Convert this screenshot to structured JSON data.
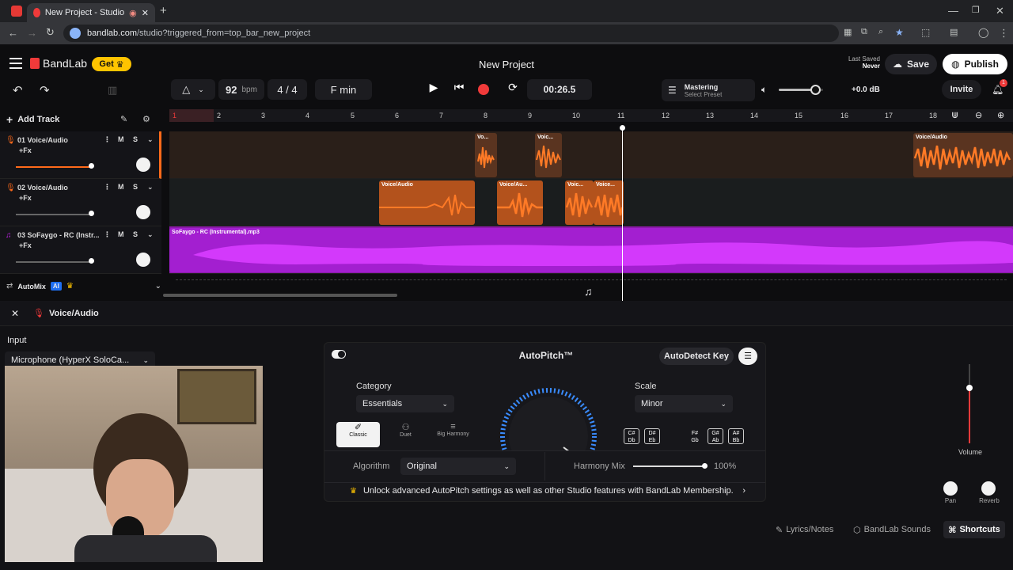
{
  "browser": {
    "tab_title": "New Project - Studio",
    "url_domain": "bandlab.com",
    "url_path": "/studio?triggered_from=top_bar_new_project"
  },
  "header": {
    "brand": "BandLab",
    "get_label": "Get",
    "project_title": "New Project",
    "last_saved_label": "Last Saved",
    "last_saved_value": "Never",
    "save_label": "Save",
    "publish_label": "Publish",
    "tempo_value": "92",
    "tempo_unit": "bpm",
    "time_sig": "4 / 4",
    "key": "F min",
    "time_display": "00:26.5",
    "mastering_label": "Mastering",
    "mastering_preset": "Select Preset",
    "db_value": "+0.0 dB",
    "invite_label": "Invite",
    "notification_count": "1"
  },
  "tracks_panel": {
    "add_track_label": "Add Track",
    "automix_label": "AutoMix",
    "ai_badge": "AI"
  },
  "ruler": [
    "1",
    "2",
    "3",
    "4",
    "5",
    "6",
    "7",
    "8",
    "9",
    "10",
    "11",
    "12",
    "13",
    "14",
    "15",
    "16",
    "17",
    "18"
  ],
  "tracks": [
    {
      "name": "01  Voice/Audio",
      "fx": "+Fx",
      "m": "M",
      "s": "S",
      "color": "#ff6a1a"
    },
    {
      "name": "02  Voice/Audio",
      "fx": "+Fx",
      "m": "M",
      "s": "S",
      "color": "#ff6a1a"
    },
    {
      "name": "03  SoFaygo - RC (Instr...",
      "fx": "+Fx",
      "m": "M",
      "s": "S",
      "color": "#c020e8"
    }
  ],
  "clips": {
    "t1": [
      "Vo...",
      "Voic...",
      "Voice/Audio"
    ],
    "t2": [
      "Voice/Audio",
      "Voice/Au...",
      "Voic...",
      "Voice..."
    ],
    "t3": [
      "SoFaygo - RC (Instrumental).mp3"
    ]
  },
  "bottom": {
    "track_title": "Voice/Audio",
    "input_label": "Input",
    "input_device": "Microphone (HyperX SoloCa...",
    "autopitch_title": "AutoPitch™",
    "autodetect_label": "AutoDetect Key",
    "category_label": "Category",
    "category_value": "Essentials",
    "scale_label": "Scale",
    "scale_value": "Minor",
    "modes": [
      "Classic",
      "Duet",
      "Big Harmony"
    ],
    "algorithm_label": "Algorithm",
    "algorithm_value": "Original",
    "harmony_mix_label": "Harmony Mix",
    "harmony_mix_value": "100%",
    "unlock_text": "Unlock advanced AutoPitch settings as well as other Studio features with BandLab Membership.",
    "notes": [
      {
        "top": "C#",
        "bot": "Db"
      },
      {
        "top": "D#",
        "bot": "Eb"
      },
      {
        "top": "F#",
        "bot": "Gb"
      },
      {
        "top": "G#",
        "bot": "Ab"
      },
      {
        "top": "A#",
        "bot": "Bb"
      }
    ],
    "volume_label": "Volume",
    "pan_label": "Pan",
    "reverb_label": "Reverb",
    "lyrics_label": "Lyrics/Notes",
    "sounds_label": "BandLab Sounds",
    "shortcuts_label": "Shortcuts"
  },
  "colors": {
    "accent": "#f03a3a",
    "orange_clip": "#ff6a1a",
    "purple_clip": "#c020e8",
    "get_yellow": "#ffc400"
  }
}
